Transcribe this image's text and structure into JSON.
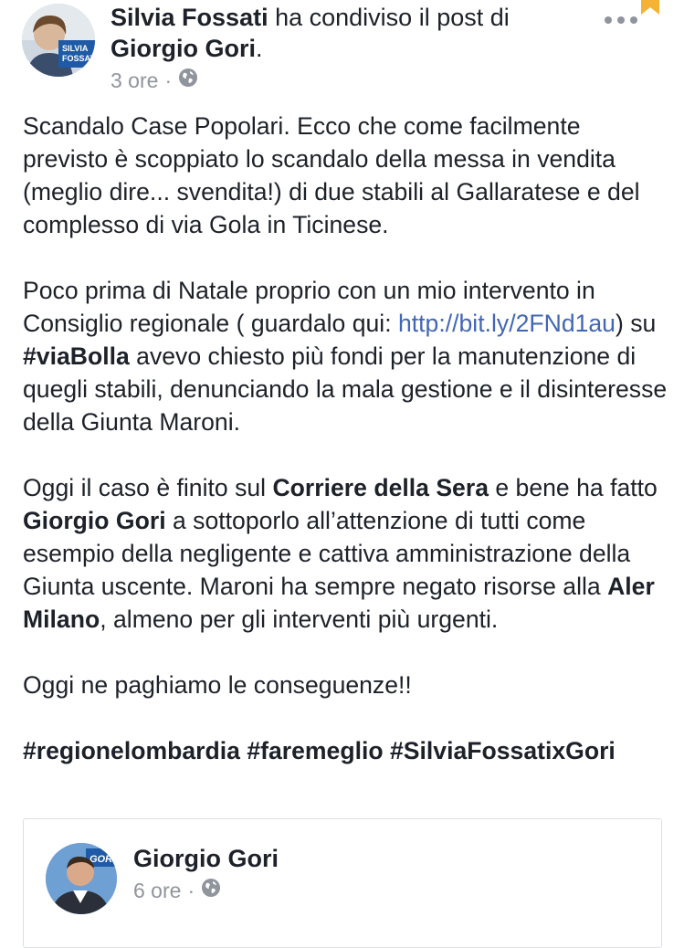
{
  "header": {
    "author": "Silvia Fossati",
    "action": "ha condiviso il post di",
    "shared_from": "Giorgio Gori",
    "period": ".",
    "time": "3 ore",
    "separator": "·",
    "avatar_badge_line1": "SILVIA",
    "avatar_badge_line2": "FOSSATI"
  },
  "post": {
    "p1": "Scandalo Case Popolari. Ecco che come facilmente previsto è scoppiato lo scandalo della messa in vendita (meglio dire... svendita!) di due stabili al Gallaratese e del complesso di via Gola in Ticinese.",
    "p2_a": "Poco prima di Natale proprio con un mio intervento in Consiglio regionale ( guardalo qui: ",
    "p2_link": "http://bit.ly/2FNd1au",
    "p2_b": ") su ",
    "p2_hashtag": "#viaBolla",
    "p2_c": " avevo chiesto più fondi per la manutenzione di quegli stabili, denunciando la mala gestione e il disinteresse della Giunta Maroni.",
    "p3_a": "Oggi il caso è finito sul ",
    "p3_b1": "Corriere della Sera",
    "p3_c": " e bene ha fatto ",
    "p3_b2": "Giorgio Gori",
    "p3_d": " a sottoporlo all’attenzione di tutti come esempio della negligente e cattiva amministrazione della Giunta uscente. Maroni ha sempre negato risorse alla ",
    "p3_b3": "Aler Milano",
    "p3_e": ", almeno per gli interventi più urgenti.",
    "p4": "Oggi ne paghiamo le conseguenze!!",
    "hashtags": "#regionelombardia #faremeglio #SilviaFossatixGori"
  },
  "shared_card": {
    "name": "Giorgio Gori",
    "time": "6 ore",
    "separator": "·",
    "avatar_badge": "GORI"
  },
  "colors": {
    "link": "#4267b2",
    "meta": "#90949c",
    "text": "#1d2129",
    "bookmark": "#f5b335"
  },
  "icons": {
    "privacy": "globe-icon",
    "menu": "more-options-icon",
    "bookmark": "bookmark-icon"
  }
}
